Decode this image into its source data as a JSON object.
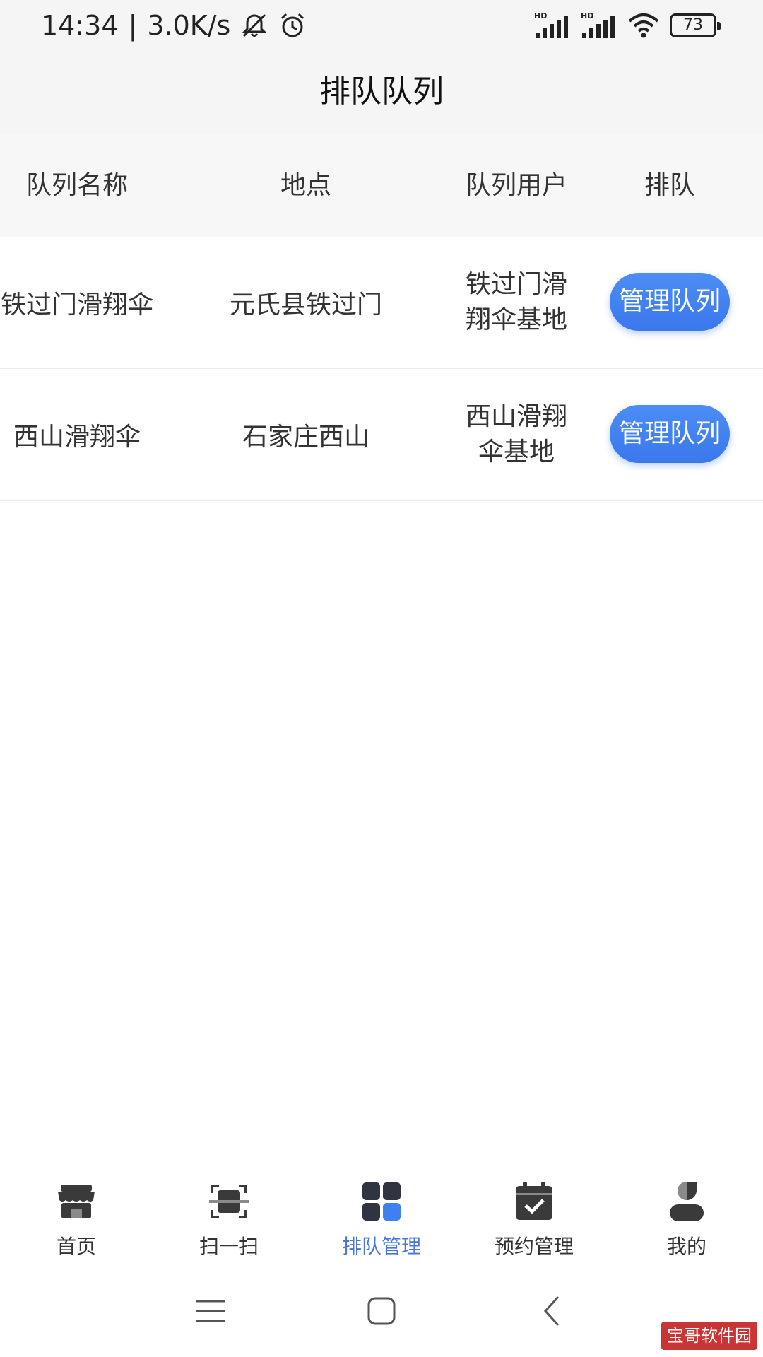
{
  "status_bar": {
    "time": "14:34",
    "separator": "|",
    "net_speed": "3.0K/s",
    "battery": "73",
    "signal_1_label": "HD",
    "signal_2_label": "HD",
    "icons": [
      "bell-muted-icon",
      "alarm-icon",
      "signal-icon",
      "signal-icon",
      "wifi-icon",
      "battery-icon"
    ]
  },
  "header": {
    "title": "排队队列"
  },
  "table": {
    "columns": [
      "队列名称",
      "地点",
      "队列用户",
      "排队"
    ],
    "rows": [
      {
        "name": "铁过门滑翔伞",
        "location": "元氏县铁过门",
        "user": "铁过门滑翔伞基地",
        "action": "管理队列"
      },
      {
        "name": "西山滑翔伞",
        "location": "石家庄西山",
        "user": "西山滑翔伞基地",
        "action": "管理队列"
      }
    ]
  },
  "tabbar": {
    "items": [
      {
        "label": "首页",
        "icon": "store-icon"
      },
      {
        "label": "扫一扫",
        "icon": "scan-icon"
      },
      {
        "label": "排队管理",
        "icon": "grid-icon",
        "active": true
      },
      {
        "label": "预约管理",
        "icon": "calendar-check-icon"
      },
      {
        "label": "我的",
        "icon": "user-icon"
      }
    ]
  },
  "navbar": {
    "icons": [
      "menu-icon",
      "home-square-icon",
      "back-icon"
    ]
  },
  "watermark": "宝哥软件园",
  "colors": {
    "accent": "#4a74d9",
    "button": "#3f7ff0",
    "header_bg": "#f5f5f5"
  }
}
